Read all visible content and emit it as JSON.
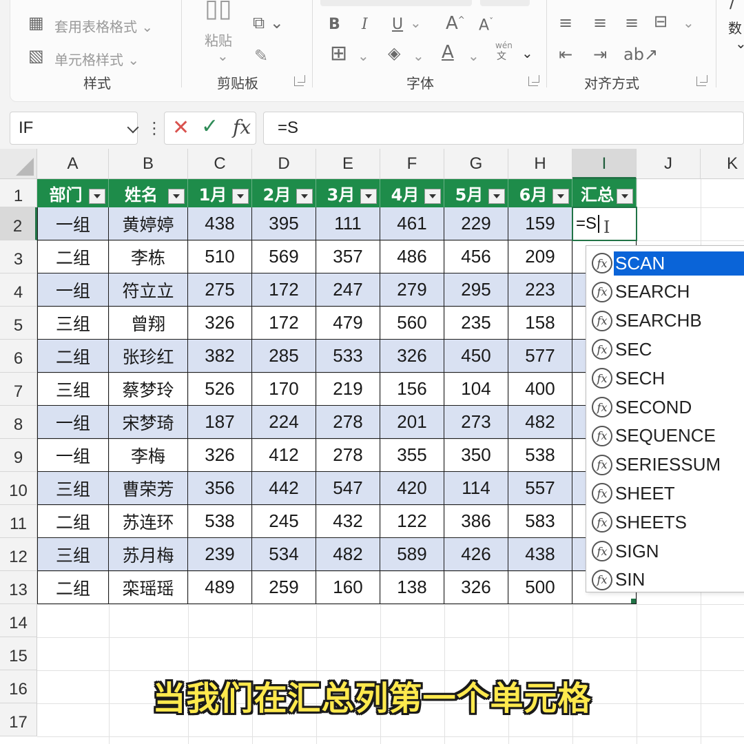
{
  "ribbon": {
    "styles_group": {
      "table_format_label": "套用表格格式",
      "cell_style_label": "单元格样式",
      "group_label": "样式"
    },
    "clipboard_group": {
      "paste_label": "粘贴",
      "group_label": "剪贴板"
    },
    "font_group": {
      "bold": "B",
      "italic": "I",
      "underline": "U",
      "grow_font": "A",
      "shrink_font": "A",
      "font_color": "A",
      "phonetic": "wén",
      "group_label": "字体"
    },
    "alignment_group": {
      "group_label": "对齐方式"
    },
    "number_group": {
      "label_fragment": "数"
    }
  },
  "formula_bar": {
    "name_box": "IF",
    "cancel_icon": "close-icon",
    "enter_icon": "check-icon",
    "fx_label": "fx",
    "formula": "=S"
  },
  "sheet": {
    "column_headers": [
      "A",
      "B",
      "C",
      "D",
      "E",
      "F",
      "G",
      "H",
      "I",
      "J",
      "K"
    ],
    "row_headers": [
      "1",
      "2",
      "3",
      "4",
      "5",
      "6",
      "7",
      "8",
      "9",
      "10",
      "11",
      "12",
      "13",
      "14",
      "15",
      "16",
      "17"
    ],
    "table_headers": [
      "部门",
      "姓名",
      "1月",
      "2月",
      "3月",
      "4月",
      "5月",
      "6月",
      "汇总"
    ],
    "rows": [
      [
        "一组",
        "黄婷婷",
        "438",
        "395",
        "111",
        "461",
        "229",
        "159"
      ],
      [
        "二组",
        "李栋",
        "510",
        "569",
        "357",
        "486",
        "456",
        "209"
      ],
      [
        "一组",
        "符立立",
        "275",
        "172",
        "247",
        "279",
        "295",
        "223"
      ],
      [
        "三组",
        "曾翔",
        "326",
        "172",
        "479",
        "560",
        "235",
        "158"
      ],
      [
        "二组",
        "张珍红",
        "382",
        "285",
        "533",
        "326",
        "450",
        "577"
      ],
      [
        "三组",
        "蔡梦玲",
        "526",
        "170",
        "219",
        "156",
        "104",
        "400"
      ],
      [
        "一组",
        "宋梦琦",
        "187",
        "224",
        "278",
        "201",
        "273",
        "482"
      ],
      [
        "一组",
        "李梅",
        "326",
        "412",
        "278",
        "355",
        "350",
        "538"
      ],
      [
        "三组",
        "曹荣芳",
        "356",
        "442",
        "547",
        "420",
        "114",
        "557"
      ],
      [
        "二组",
        "苏连环",
        "538",
        "245",
        "432",
        "122",
        "386",
        "583"
      ],
      [
        "三组",
        "苏月梅",
        "239",
        "534",
        "482",
        "589",
        "426",
        "438"
      ],
      [
        "二组",
        "栾瑶瑶",
        "489",
        "259",
        "160",
        "138",
        "326",
        "500"
      ]
    ],
    "active_cell_text": "=S",
    "header_color": "#1e8c4a",
    "band_color": "#d9e1f2"
  },
  "autocomplete": {
    "items": [
      "SCAN",
      "SEARCH",
      "SEARCHB",
      "SEC",
      "SECH",
      "SECOND",
      "SEQUENCE",
      "SERIESSUM",
      "SHEET",
      "SHEETS",
      "SIGN",
      "SIN"
    ],
    "selected_index": 0,
    "item_icon": "function-icon",
    "highlight_color": "#0a64d8"
  },
  "subtitle": "当我们在汇总列第一个单元格"
}
